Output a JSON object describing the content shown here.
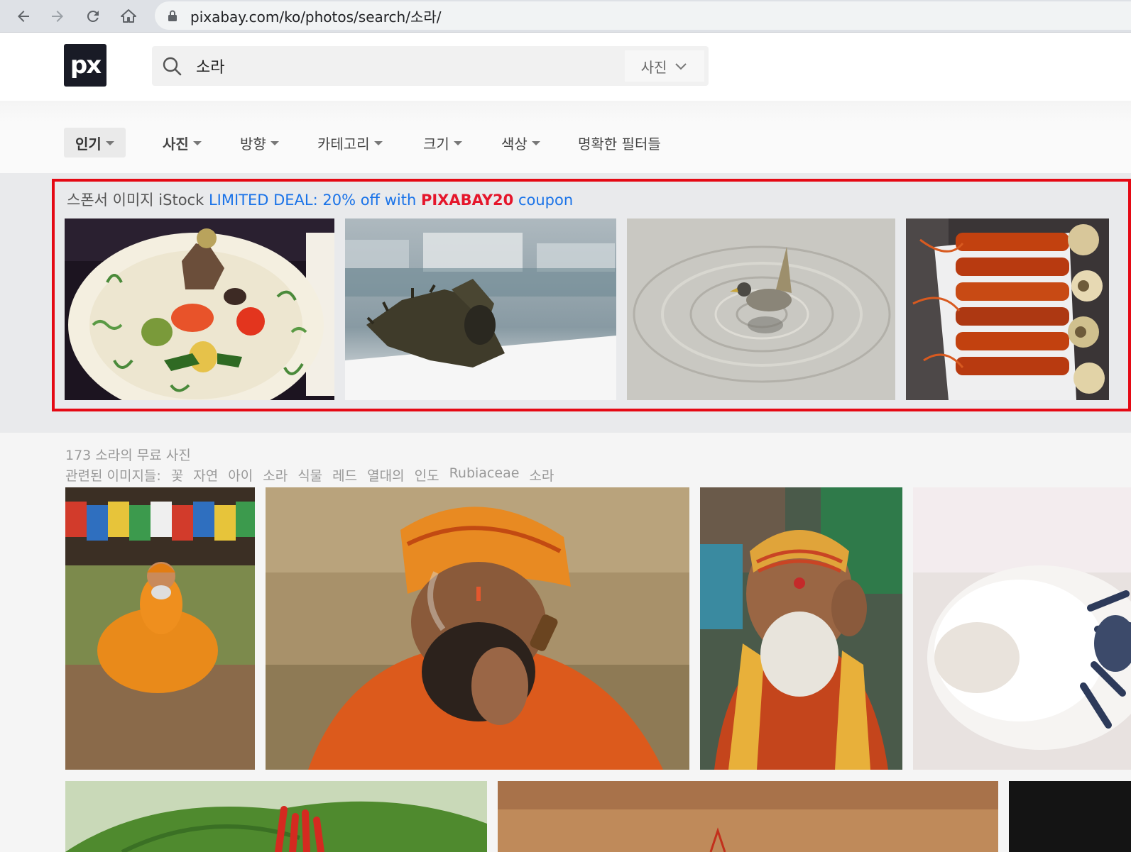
{
  "browser": {
    "url": "pixabay.com/ko/photos/search/소라/"
  },
  "header": {
    "logo_text": "px",
    "search": {
      "value": "소라"
    },
    "search_type": "사진"
  },
  "filters": [
    {
      "label": "인기"
    },
    {
      "label": "사진"
    },
    {
      "label": "방향"
    },
    {
      "label": "카테고리"
    },
    {
      "label": "크기"
    },
    {
      "label": "색상"
    },
    {
      "label": "명확한 필터들"
    }
  ],
  "sponsor": {
    "label": "스폰서 이미지",
    "brand": "iStock",
    "deal": "LIMITED DEAL: 20% off with",
    "code": "PIXABAY20",
    "coupon": "coupon"
  },
  "results": {
    "count_text": "173 소라의 무료 사진",
    "related_label": "관련된 이미지들:",
    "related_tags": [
      "꽃",
      "자연",
      "아이",
      "소라",
      "식물",
      "레드",
      "열대의",
      "인도",
      "Rubiaceae",
      "소라"
    ]
  },
  "colors": {
    "accent_blue": "#1a73e8",
    "coupon_red": "#e5162b",
    "highlight_border": "#e50914"
  }
}
